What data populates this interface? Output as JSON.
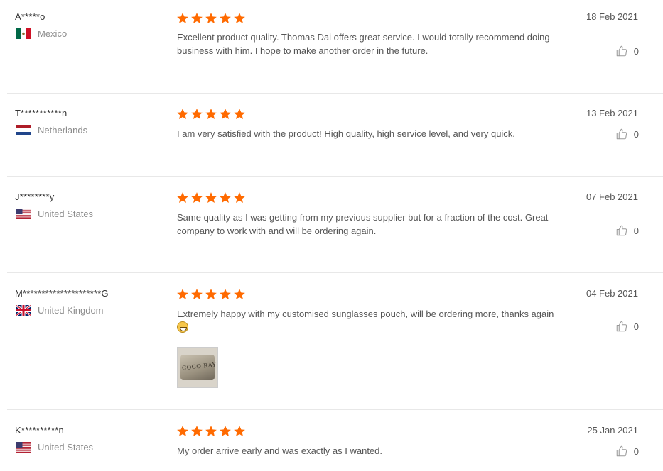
{
  "colors": {
    "star": "#ff6a00",
    "divider": "#e8e8e8",
    "muted": "#8c8c8c"
  },
  "reviews": [
    {
      "name": "A*****o",
      "country": "Mexico",
      "flag_icon": "mexico-flag-icon",
      "rating": 5,
      "text": "Excellent product quality. Thomas Dai offers great service. I would totally recommend doing business with him. I hope to make another order in the future.",
      "date": "18 Feb 2021",
      "likes": "0"
    },
    {
      "name": "T***********n",
      "country": "Netherlands",
      "flag_icon": "netherlands-flag-icon",
      "rating": 5,
      "text": "I am very satisfied with the product! High quality, high service level, and very quick.",
      "date": "13 Feb 2021",
      "likes": "0"
    },
    {
      "name": "J********y",
      "country": "United States",
      "flag_icon": "usa-flag-icon",
      "rating": 5,
      "text": "Same quality as I was getting from my previous supplier but for a fraction of the cost. Great company to work with and will be ordering again.",
      "date": "07 Feb 2021",
      "likes": "0"
    },
    {
      "name": "M*********************G",
      "country": "United Kingdom",
      "flag_icon": "uk-flag-icon",
      "rating": 5,
      "text": "Extremely happy with my customised sunglasses pouch, will be ordering more, thanks again",
      "emoji_icon": "grinning-emoji-icon",
      "image_brand_text": "COCO RAY",
      "date": "04 Feb 2021",
      "likes": "0"
    },
    {
      "name": "K**********n",
      "country": "United States",
      "flag_icon": "usa-flag-icon",
      "rating": 5,
      "text": "My order arrive early and was exactly as I wanted.",
      "date": "25 Jan 2021",
      "likes": "0"
    }
  ]
}
